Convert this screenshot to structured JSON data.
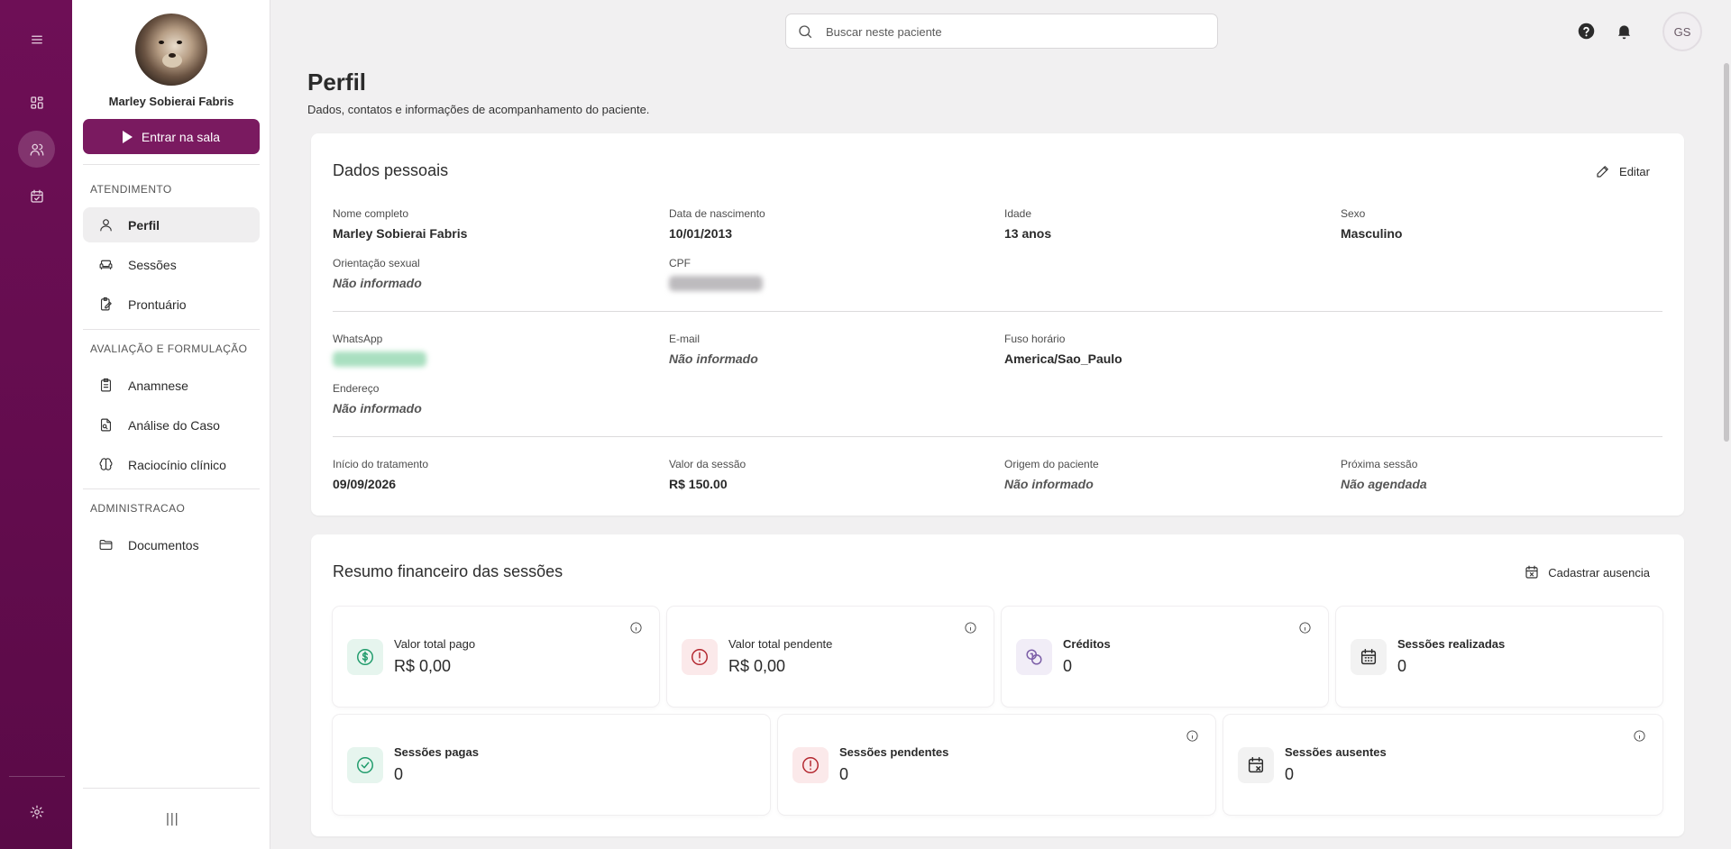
{
  "rail": {
    "items": [
      "menu-icon",
      "dashboard-icon",
      "patients-icon",
      "calendar-icon"
    ],
    "settings": "settings-icon"
  },
  "sidebar": {
    "patient_name": "Marley Sobierai Fabris",
    "enter_button": "Entrar na sala",
    "sections": [
      {
        "title": "ATENDIMENTO",
        "items": [
          "Perfil",
          "Sessões",
          "Prontuário"
        ]
      },
      {
        "title": "AVALIAÇÃO E FORMULAÇÃO",
        "items": [
          "Anamnese",
          "Análise do Caso",
          "Raciocínio clínico"
        ]
      },
      {
        "title": "ADMINISTRACAO",
        "items": [
          "Documentos"
        ]
      }
    ],
    "active_item": "Perfil",
    "collapse_glyph": "|||"
  },
  "topbar": {
    "search_placeholder": "Buscar neste paciente",
    "user_initials": "GS"
  },
  "page": {
    "title": "Perfil",
    "subtitle": "Dados, contatos e informações de acompanhamento do paciente."
  },
  "personal": {
    "title": "Dados pessoais",
    "edit_label": "Editar",
    "fields": {
      "nome_label": "Nome completo",
      "nome_value": "Marley Sobierai Fabris",
      "nasc_label": "Data de nascimento",
      "nasc_value": "10/01/2013",
      "idade_label": "Idade",
      "idade_value": "13 anos",
      "sexo_label": "Sexo",
      "sexo_value": "Masculino",
      "orient_label": "Orientação sexual",
      "orient_value": "Não informado",
      "cpf_label": "CPF",
      "whats_label": "WhatsApp",
      "email_label": "E-mail",
      "email_value": "Não informado",
      "fuso_label": "Fuso horário",
      "fuso_value": "America/Sao_Paulo",
      "end_label": "Endereço",
      "end_value": "Não informado",
      "inicio_label": "Início do tratamento",
      "inicio_value": "09/09/2026",
      "valor_label": "Valor da sessão",
      "valor_value": "R$ 150.00",
      "origem_label": "Origem do paciente",
      "origem_value": "Não informado",
      "prox_label": "Próxima sessão",
      "prox_value": "Não agendada"
    }
  },
  "finance": {
    "title": "Resumo financeiro das sessões",
    "action_label": "Cadastrar ausencia",
    "stats": {
      "pago_label": "Valor total pago",
      "pago_value": "R$ 0,00",
      "pend_label": "Valor total pendente",
      "pend_value": "R$ 0,00",
      "cred_label": "Créditos",
      "cred_value": "0",
      "real_label": "Sessões realizadas",
      "real_value": "0",
      "spagas_label": "Sessões pagas",
      "spagas_value": "0",
      "spend_label": "Sessões pendentes",
      "spend_value": "0",
      "saus_label": "Sessões ausentes",
      "saus_value": "0"
    }
  },
  "colors": {
    "brand": "#6e0f56",
    "button": "#7a1a60",
    "green": "#1f9b6b",
    "red": "#b3262e",
    "purple": "#7b5ea7"
  }
}
